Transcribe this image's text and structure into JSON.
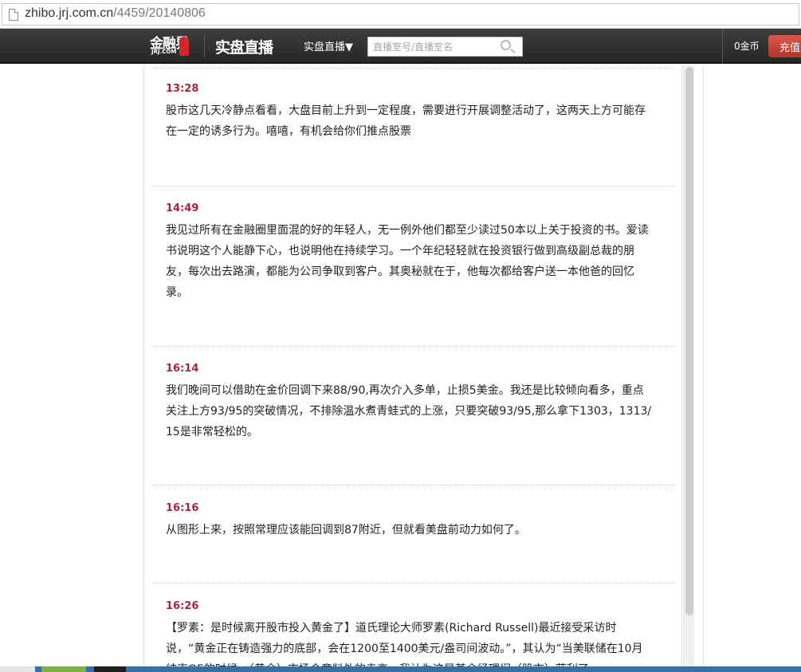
{
  "browser": {
    "url_host": "zhibo.jrj.com.cn",
    "url_path": "/4459/20140806"
  },
  "header": {
    "logo_cn": "金融界",
    "logo_en": "JRJ.COM",
    "live_logo": "实盘直播",
    "nav_dropdown": "实盘直播▼",
    "search_placeholder": "直播室号/直播室名",
    "coins": "0金币",
    "recharge_label": "充值"
  },
  "entries": [
    {
      "time": "13:28",
      "text": "股市这几天冷静点看看，大盘目前上升到一定程度，需要进行开展调整活动了，这两天上方可能存在一定的诱多行为。嘻嘻，有机会给你们推点股票"
    },
    {
      "time": "14:49",
      "text": "我见过所有在金融圈里面混的好的年轻人，无一例外他们都至少读过50本以上关于投资的书。爱读书说明这个人能静下心，也说明他在持续学习。一个年纪轻轻就在投资银行做到高级副总裁的朋友，每次出去路演，都能为公司争取到客户。其奥秘就在于，他每次都给客户送一本他爸的回忆录。"
    },
    {
      "time": "16:14",
      "text": "我们晚间可以借助在金价回调下来88/90,再次介入多单，止损5美金。我还是比较倾向看多，重点关注上方93/95的突破情况，不排除温水煮青蛙式的上涨，只要突破93/95,那么拿下1303，1313/15是非常轻松的。"
    },
    {
      "time": "16:16",
      "text": "从图形上来，按照常理应该能回调到87附近，但就看美盘前动力如何了。"
    },
    {
      "time": "16:26",
      "text": "【罗素：是时候离开股市投入黄金了】道氏理论大师罗素(Richard Russell)最近接受采访时说，“黄金正在铸造强力的底部，会在1200至1400美元/盎司间波动。”，其认为“当美联储在10月结束QE的时候，（黄金）市场会意料外的走高。我认为这是基金经理们（股市）获利了"
    }
  ]
}
